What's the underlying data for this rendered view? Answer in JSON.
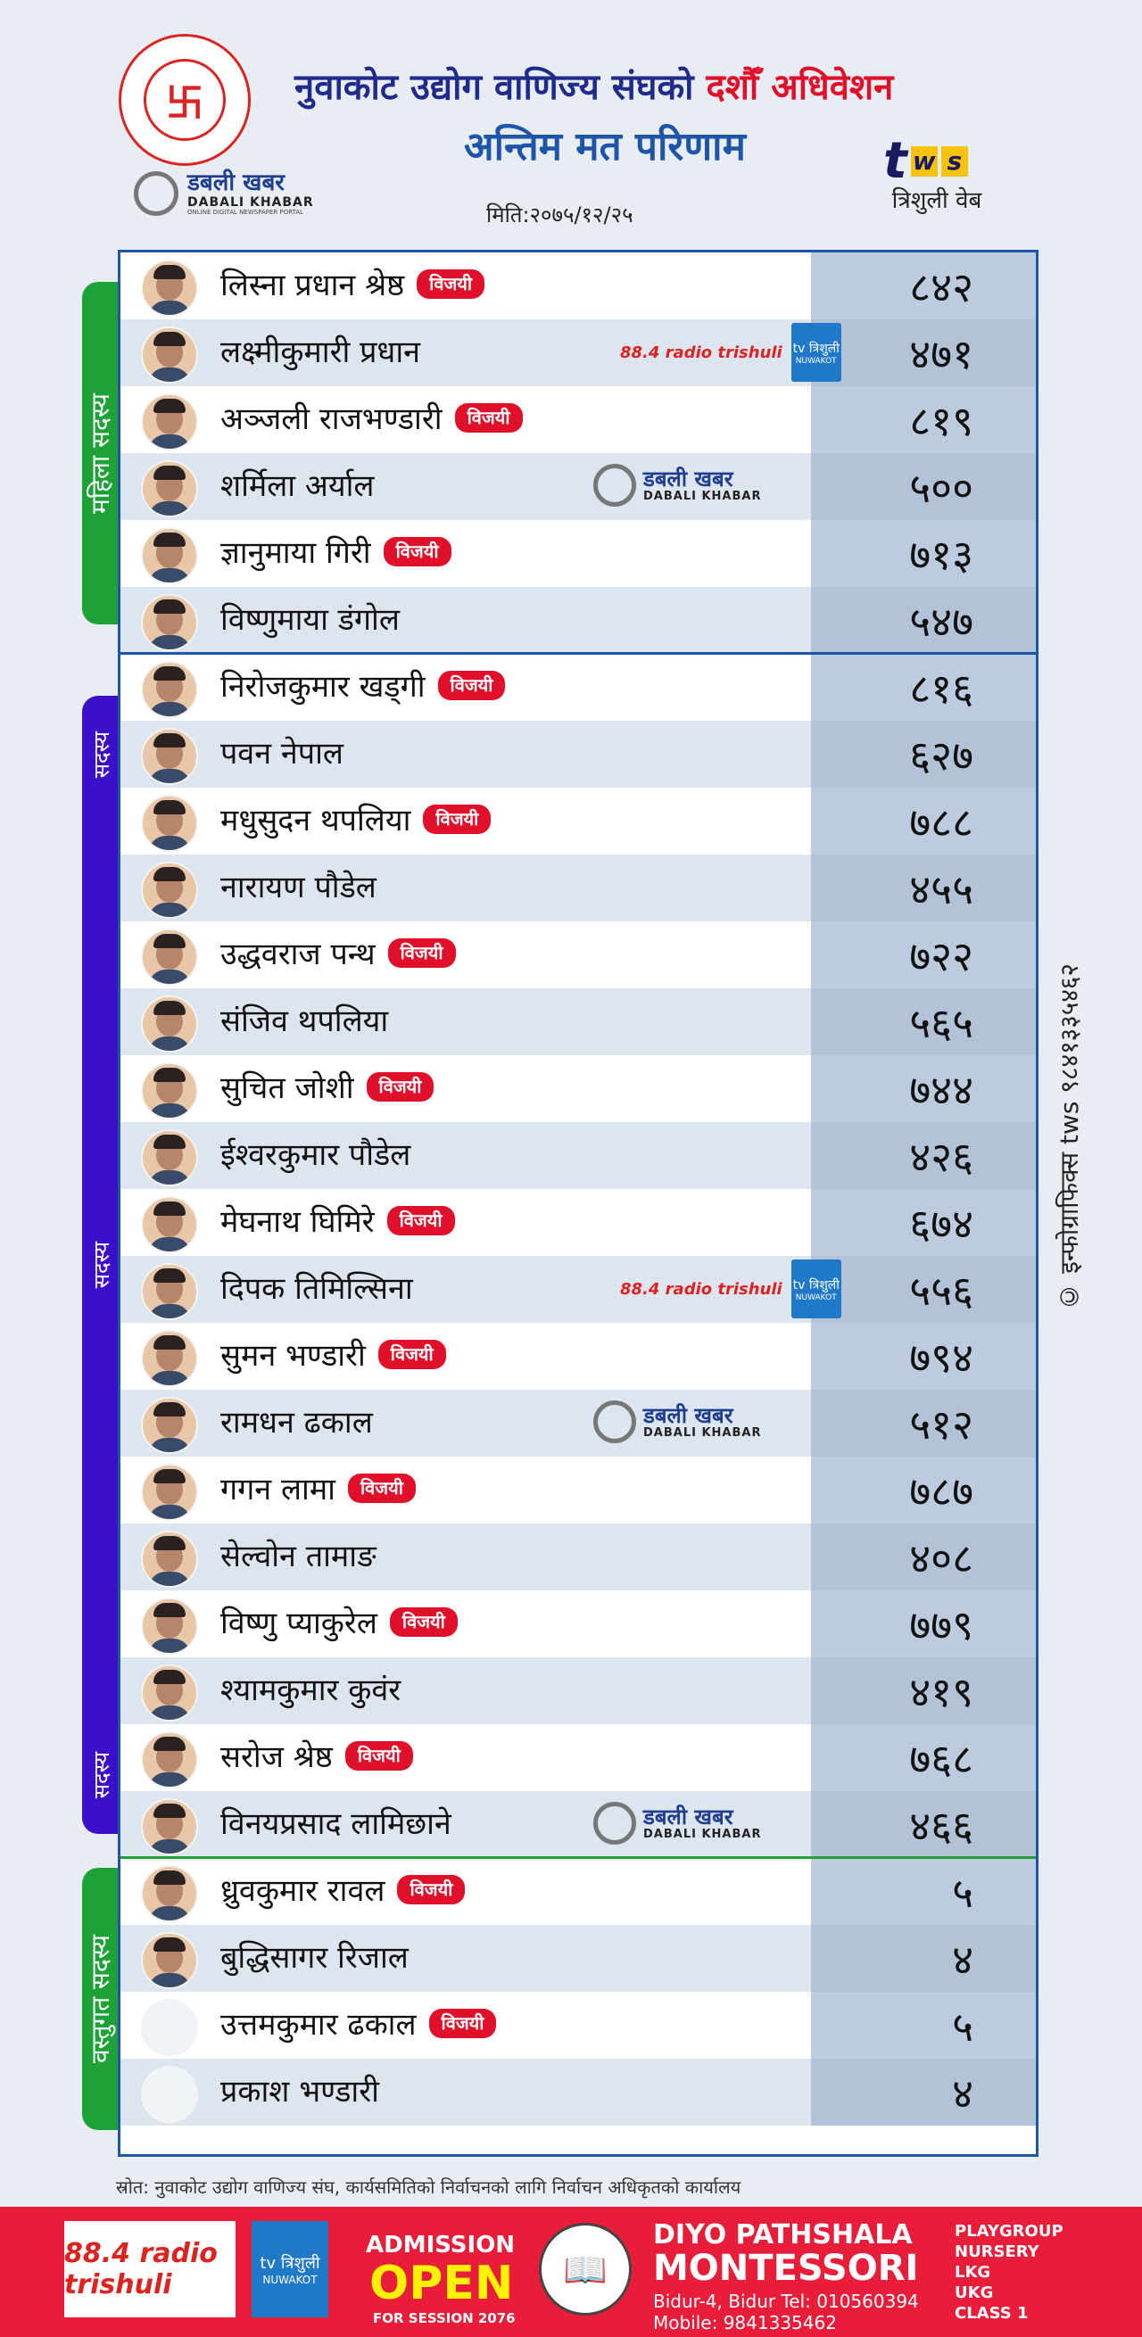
{
  "header": {
    "title_part1": "नुवाकोट उद्योग वाणिज्य संघको",
    "title_highlight": "दशौँ अधिवेशन",
    "subtitle": "अन्तिम मत परिणाम",
    "date": "मिति:२०७५/१२/२५",
    "logo_symbol": "卐",
    "dabali": {
      "name": "डबली खबर",
      "name_en": "DABALI KHABAR",
      "tagline": "ONLINE DIGITAL NEWSPAPER PORTAL"
    },
    "tws": {
      "t": "t",
      "w": "w",
      "s": "s",
      "caption": "त्रिशुली वेब"
    }
  },
  "sections": [
    {
      "label": "महिला सदस्य",
      "color": "#1ea237"
    },
    {
      "label_top": "सदस्य",
      "label_mid": "सदस्य",
      "label_bot": "सदस्य",
      "color": "#3a10c8"
    },
    {
      "label": "वस्तुगत सदस्य",
      "color": "#1ea237"
    }
  ],
  "winner_label": "विजयी",
  "candidates": [
    {
      "name": "लिस्ना प्रधान श्रेष्ठ",
      "votes": "८४२",
      "winner": true
    },
    {
      "name": "लक्ष्मीकुमारी प्रधान",
      "votes": "४७१",
      "winner": false,
      "sponsor": "radio"
    },
    {
      "name": "अञ्जली राजभण्डारी",
      "votes": "८१९",
      "winner": true
    },
    {
      "name": "शर्मिला अर्याल",
      "votes": "५००",
      "winner": false,
      "sponsor": "dabali"
    },
    {
      "name": "ज्ञानुमाया गिरी",
      "votes": "७१३",
      "winner": true
    },
    {
      "name": "विष्णुमाया डंगोल",
      "votes": "५४७",
      "winner": false
    },
    {
      "name": "निरोजकुमार खड्गी",
      "votes": "८१६",
      "winner": true
    },
    {
      "name": "पवन नेपाल",
      "votes": "६२७",
      "winner": false
    },
    {
      "name": "मधुसुदन थपलिया",
      "votes": "७८८",
      "winner": true
    },
    {
      "name": "नारायण पौडेल",
      "votes": "४५५",
      "winner": false
    },
    {
      "name": "उद्धवराज पन्थ",
      "votes": "७२२",
      "winner": true
    },
    {
      "name": "संजिव थपलिया",
      "votes": "५६५",
      "winner": false
    },
    {
      "name": "सुचित जोशी",
      "votes": "७४४",
      "winner": true
    },
    {
      "name": "ईश्वरकुमार पौडेल",
      "votes": "४२६",
      "winner": false
    },
    {
      "name": "मेघनाथ घिमिरे",
      "votes": "६७४",
      "winner": true
    },
    {
      "name": "दिपक तिमिल्सिना",
      "votes": "५५६",
      "winner": false,
      "sponsor": "radio"
    },
    {
      "name": "सुमन भण्डारी",
      "votes": "७९४",
      "winner": true
    },
    {
      "name": "रामधन ढकाल",
      "votes": "५१२",
      "winner": false,
      "sponsor": "dabali"
    },
    {
      "name": "गगन लामा",
      "votes": "७८७",
      "winner": true
    },
    {
      "name": "सेल्वोन तामाङ",
      "votes": "४०८",
      "winner": false
    },
    {
      "name": "विष्णु प्याकुरेल",
      "votes": "७७९",
      "winner": true
    },
    {
      "name": "श्यामकुमार कुवंर",
      "votes": "४१९",
      "winner": false
    },
    {
      "name": "सरोज श्रेष्ठ",
      "votes": "७६८",
      "winner": true
    },
    {
      "name": "विनयप्रसाद लामिछाने",
      "votes": "४६६",
      "winner": false,
      "sponsor": "dabali"
    },
    {
      "name": "ध्रुवकुमार रावल",
      "votes": "५",
      "winner": true
    },
    {
      "name": "बुद्धिसागर रिजाल",
      "votes": "४",
      "winner": false
    },
    {
      "name": "उत्तमकुमार ढकाल",
      "votes": "५",
      "winner": true,
      "blank": true
    },
    {
      "name": "प्रकाश भण्डारी",
      "votes": "४",
      "winner": false,
      "blank": true
    }
  ],
  "sponsor_radio": {
    "label": "88.4 radio trishuli",
    "tv_label": "tv त्रिशुली",
    "tv_sub": "NUWAKOT"
  },
  "watermark": "© इन्फोग्राफिक्स tws ९८४१३३५४६२",
  "source": "स्रोत: नुवाकोट उद्योग वाणिज्य संघ, कार्यसमितिको निर्वाचनको लागि निर्वाचन अधिकृतको कार्यालय",
  "footer": {
    "radio": "88.4 radio trishuli",
    "tv": "tv त्रिशुली",
    "tv_sub": "NUWAKOT",
    "admission": "ADMISSION",
    "open": "OPEN",
    "session": "FOR SESSION 2076",
    "school_line1": "DIYO PATHSHALA",
    "school_line2": "MONTESSORI",
    "address": "Bidur-4, Bidur   Tel: 010560394",
    "mobile": "Mobile: 9841335462",
    "classes": [
      "PLAYGROUP",
      "NURSERY",
      "LKG",
      "UKG",
      "CLASS 1"
    ]
  },
  "colors": {
    "accent_red": "#e0102a",
    "primary_blue": "#1f55a8",
    "footer_red": "#e81d3a"
  }
}
